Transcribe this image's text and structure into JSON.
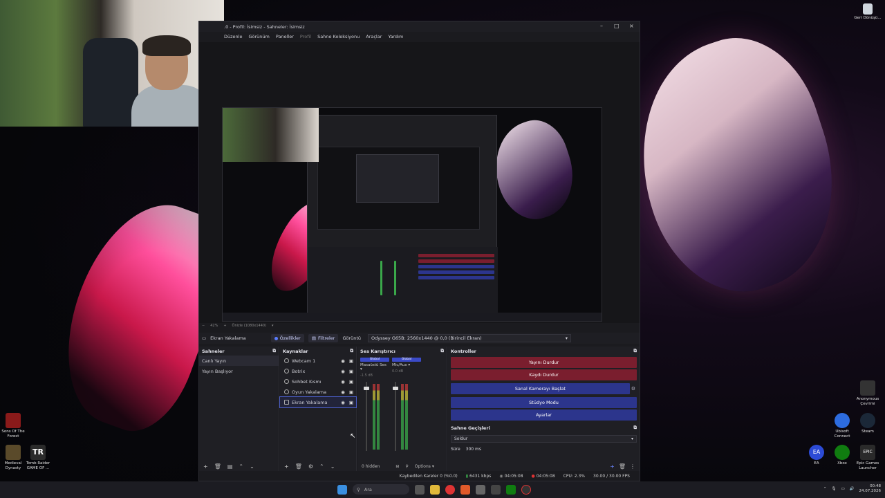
{
  "desktop": {
    "top_right_icon": {
      "label": "Geri Dönüşü...",
      "icon": "recycle-bin-icon"
    },
    "left_icons": [
      {
        "label": "Sons Of The Forest",
        "icon": "game-icon"
      },
      {
        "label": "Medieval Dynasty",
        "icon": "game-icon"
      },
      {
        "label": "Tomb Raider GAME OF ...",
        "icon": "game-icon",
        "logo_text": "TR"
      }
    ],
    "right_icons": [
      {
        "label": "Anonymous Çevrimi",
        "icon": "app-icon"
      },
      {
        "label": "Ubisoft Connect",
        "icon": "ubisoft-icon"
      },
      {
        "label": "Steam",
        "icon": "steam-icon"
      },
      {
        "label": "EA",
        "icon": "ea-icon",
        "logo_text": "EA"
      },
      {
        "label": "Xbox",
        "icon": "xbox-icon"
      },
      {
        "label": "Epic Games Launcher",
        "icon": "epic-icon",
        "logo_text": "EPIC"
      }
    ]
  },
  "obs": {
    "title": ".0 - Profil: İsimsiz - Sahneler: İsimsiz",
    "menu": [
      "Düzenle",
      "Görünüm",
      "Paneller",
      "Profil",
      "Sahne Koleksiyonu",
      "Araçlar",
      "Yardım"
    ],
    "zoom": {
      "percent": "42%",
      "label": "Önizle (1080x1440)"
    },
    "source_toolbar": {
      "selected_source": "Ekran Yakalama",
      "properties": "Özellikler",
      "filters": "Filtreler",
      "display_label": "Görüntü",
      "display_value": "Odyssey G65B: 2560x1440 @ 0,0 (Birincil Ekran)"
    },
    "scenes": {
      "title": "Sahneler",
      "items": [
        "Canlı Yayın",
        "Yayın Başlıyor"
      ]
    },
    "sources": {
      "title": "Kaynaklar",
      "items": [
        {
          "label": "Webcam 1",
          "icon": "camera-icon"
        },
        {
          "label": "Botrix",
          "icon": "browser-icon"
        },
        {
          "label": "Sohbet Kısmı",
          "icon": "browser-icon"
        },
        {
          "label": "Oyun Yakalama",
          "icon": "gamepad-icon"
        },
        {
          "label": "Ekran Yakalama",
          "icon": "monitor-icon"
        }
      ]
    },
    "mixer": {
      "title": "Ses Karıştırıcı",
      "channels": [
        {
          "tag": "Global",
          "name": "Masaüstü Ses",
          "db": "-1.5 dB"
        },
        {
          "tag": "Global",
          "name": "Mic/Aux",
          "db": "0.0 dB"
        }
      ],
      "hidden": "0 hidden",
      "options": "Options"
    },
    "controls": {
      "title": "Kontroller",
      "buttons": [
        "Yayını Durdur",
        "Kaydı Durdur",
        "Sanal Kamerayı Başlat",
        "Stüdyo Modu",
        "Ayarlar"
      ]
    },
    "transitions": {
      "title": "Sahne Geçişleri",
      "selected": "Soldur",
      "duration_label": "Süre",
      "duration_value": "300 ms"
    },
    "status": {
      "dropped": "Kaybedilen Kareler 0 (%0.0)",
      "bitrate": "6431 kbps",
      "stream_time": "04:05:08",
      "rec_time": "04:05:08",
      "cpu": "CPU: 2.3%",
      "fps": "30.00 / 30.00 FPS"
    }
  },
  "taskbar": {
    "search_placeholder": "Ara",
    "time": "00:48",
    "date": "24.07.2026"
  }
}
